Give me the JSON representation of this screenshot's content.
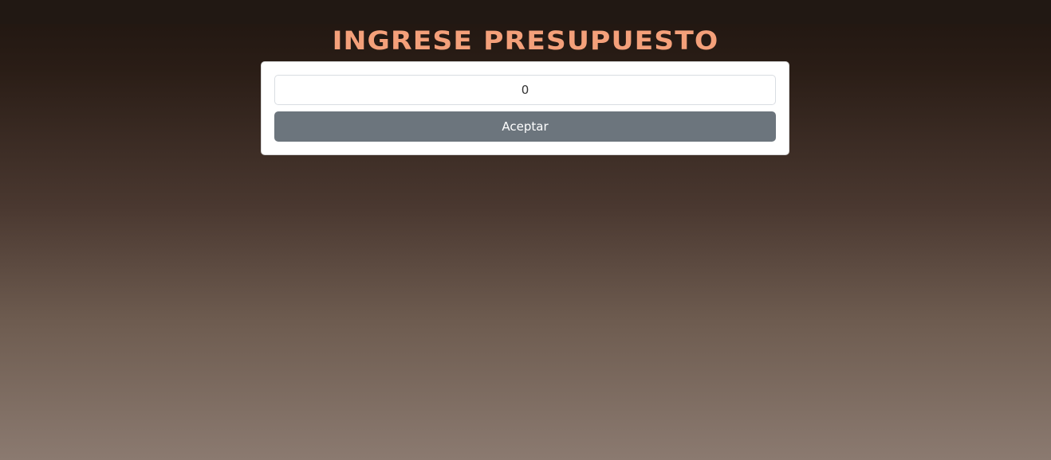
{
  "header": {
    "title": "INGRESE PRESUPUESTO"
  },
  "form": {
    "budget_value": "0",
    "accept_label": "Aceptar"
  },
  "colors": {
    "title": "#f4a07a",
    "button": "#6c757d"
  }
}
